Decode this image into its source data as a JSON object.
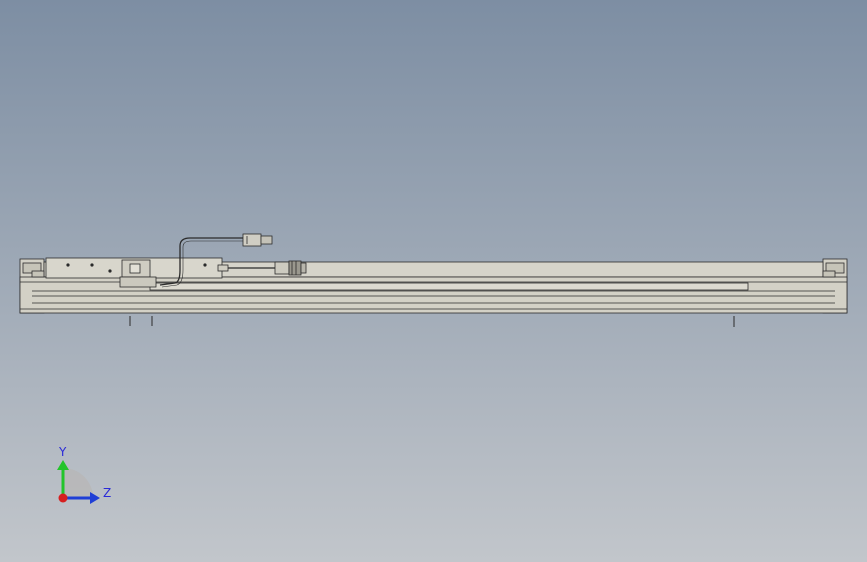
{
  "viewport": {
    "background_top": "#7d8ea3",
    "background_bottom": "#c2c6cb"
  },
  "model": {
    "body_fill": "#d3d1c6",
    "edge_color": "#2b2b2b",
    "rail_fill": "#c9c7bb"
  },
  "triad": {
    "y_label": "Y",
    "z_label": "Z",
    "y_color": "#22c42a",
    "z_color": "#1f3fd6",
    "x_color": "#d61f1f",
    "label_color": "#2a2ad8"
  }
}
